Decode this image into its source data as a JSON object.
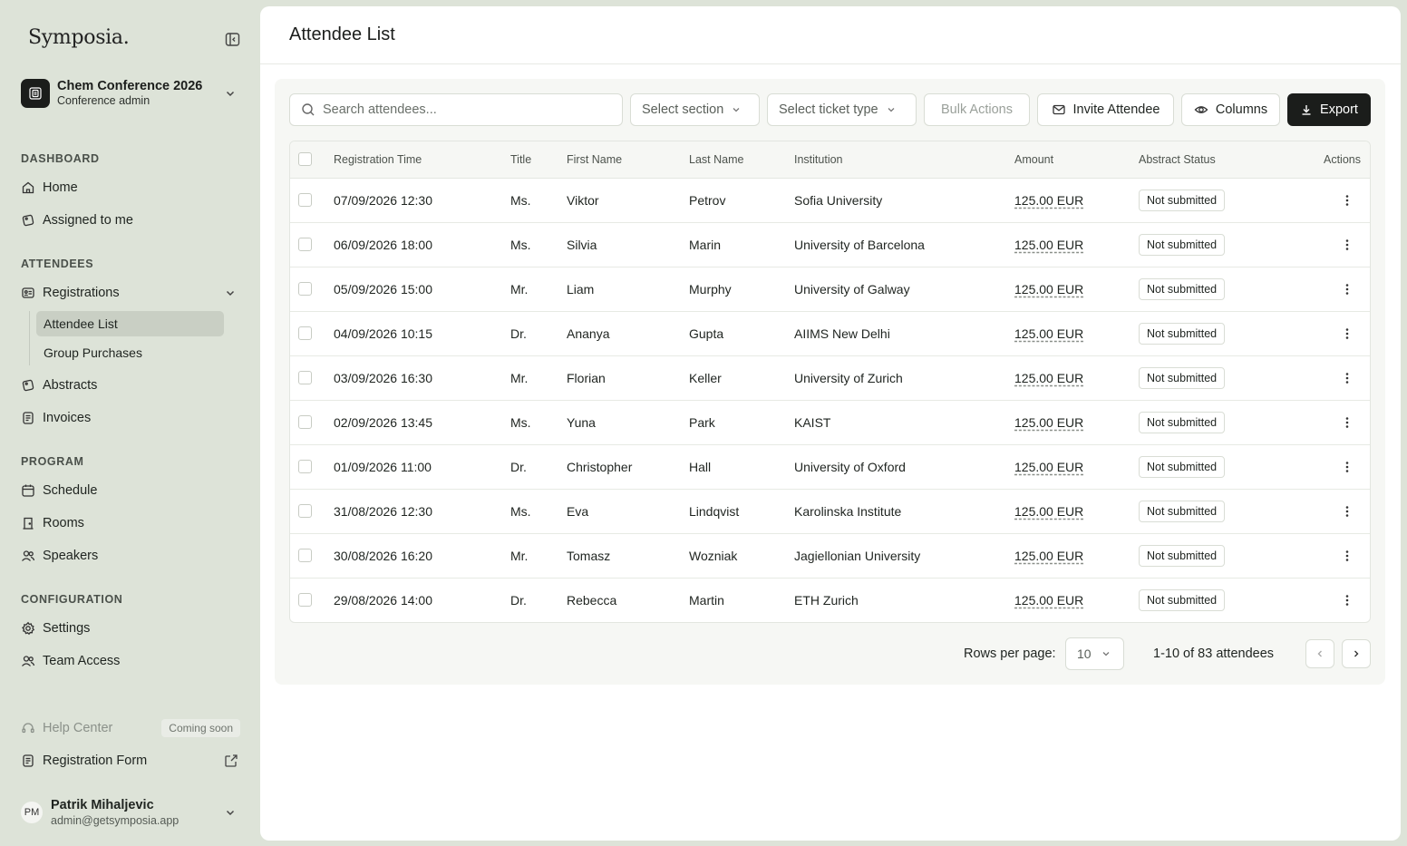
{
  "brand": {
    "logo": "Symposia."
  },
  "org": {
    "name": "Chem Conference 2026",
    "role": "Conference admin"
  },
  "sidebar": {
    "sections": {
      "dashboard": "DASHBOARD",
      "attendees": "ATTENDEES",
      "program": "PROGRAM",
      "configuration": "CONFIGURATION"
    },
    "items": {
      "home": "Home",
      "assigned": "Assigned to me",
      "registrations": "Registrations",
      "attendee_list": "Attendee List",
      "group_purchases": "Group Purchases",
      "abstracts": "Abstracts",
      "invoices": "Invoices",
      "schedule": "Schedule",
      "rooms": "Rooms",
      "speakers": "Speakers",
      "settings": "Settings",
      "team_access": "Team Access",
      "help_center": "Help Center",
      "coming_soon": "Coming soon",
      "registration_form": "Registration Form"
    }
  },
  "user": {
    "initials": "PM",
    "name": "Patrik Mihaljevic",
    "email": "admin@getsymposia.app"
  },
  "page": {
    "title": "Attendee List"
  },
  "toolbar": {
    "search_placeholder": "Search attendees...",
    "section_select": "Select section",
    "ticket_select": "Select ticket type",
    "bulk_actions": "Bulk Actions",
    "invite": "Invite Attendee",
    "columns": "Columns",
    "export": "Export"
  },
  "table": {
    "headers": {
      "time": "Registration Time",
      "title": "Title",
      "first": "First Name",
      "last": "Last Name",
      "institution": "Institution",
      "amount": "Amount",
      "status": "Abstract Status",
      "actions": "Actions"
    },
    "rows": [
      {
        "time": "07/09/2026 12:30",
        "title": "Ms.",
        "first": "Viktor",
        "last": "Petrov",
        "institution": "Sofia University",
        "amount": "125.00 EUR",
        "status": "Not submitted"
      },
      {
        "time": "06/09/2026 18:00",
        "title": "Ms.",
        "first": "Silvia",
        "last": "Marin",
        "institution": "University of Barcelona",
        "amount": "125.00 EUR",
        "status": "Not submitted"
      },
      {
        "time": "05/09/2026 15:00",
        "title": "Mr.",
        "first": "Liam",
        "last": "Murphy",
        "institution": "University of Galway",
        "amount": "125.00 EUR",
        "status": "Not submitted"
      },
      {
        "time": "04/09/2026 10:15",
        "title": "Dr.",
        "first": "Ananya",
        "last": "Gupta",
        "institution": "AIIMS New Delhi",
        "amount": "125.00 EUR",
        "status": "Not submitted"
      },
      {
        "time": "03/09/2026 16:30",
        "title": "Mr.",
        "first": "Florian",
        "last": "Keller",
        "institution": "University of Zurich",
        "amount": "125.00 EUR",
        "status": "Not submitted"
      },
      {
        "time": "02/09/2026 13:45",
        "title": "Ms.",
        "first": "Yuna",
        "last": "Park",
        "institution": "KAIST",
        "amount": "125.00 EUR",
        "status": "Not submitted"
      },
      {
        "time": "01/09/2026 11:00",
        "title": "Dr.",
        "first": "Christopher",
        "last": "Hall",
        "institution": "University of Oxford",
        "amount": "125.00 EUR",
        "status": "Not submitted"
      },
      {
        "time": "31/08/2026 12:30",
        "title": "Ms.",
        "first": "Eva",
        "last": "Lindqvist",
        "institution": "Karolinska Institute",
        "amount": "125.00 EUR",
        "status": "Not submitted"
      },
      {
        "time": "30/08/2026 16:20",
        "title": "Mr.",
        "first": "Tomasz",
        "last": "Wozniak",
        "institution": "Jagiellonian University",
        "amount": "125.00 EUR",
        "status": "Not submitted"
      },
      {
        "time": "29/08/2026 14:00",
        "title": "Dr.",
        "first": "Rebecca",
        "last": "Martin",
        "institution": "ETH Zurich",
        "amount": "125.00 EUR",
        "status": "Not submitted"
      }
    ]
  },
  "pagination": {
    "rows_label": "Rows per page:",
    "rows_value": "10",
    "range": "1-10 of 83 attendees"
  }
}
